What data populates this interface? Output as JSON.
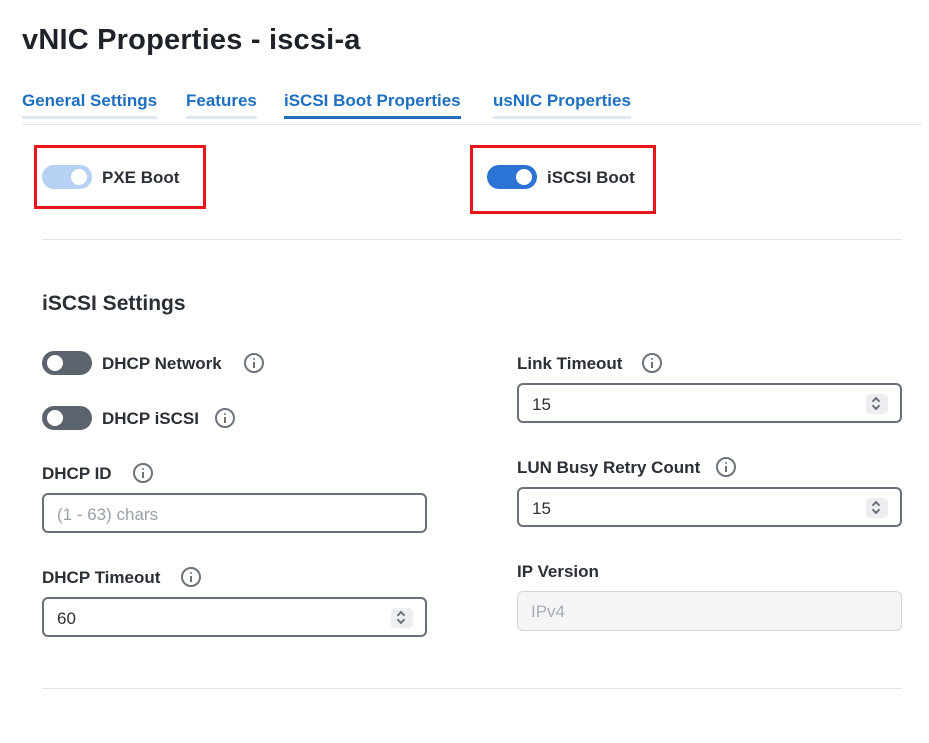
{
  "page": {
    "title": "vNIC Properties - iscsi-a"
  },
  "tabs": [
    "General Settings",
    "Features",
    "iSCSI Boot Properties",
    "usNIC Properties"
  ],
  "active_tab": "iSCSI Boot Properties",
  "boot": {
    "pxe": {
      "label": "PXE Boot",
      "state": "on",
      "disabled": true
    },
    "iscsi": {
      "label": "iSCSI Boot",
      "state": "on"
    }
  },
  "settings": {
    "title": "iSCSI Settings",
    "dhcp_network": {
      "label": "DHCP Network",
      "state": "off"
    },
    "dhcp_iscsi": {
      "label": "DHCP iSCSI",
      "state": "off"
    },
    "dhcp_id": {
      "label": "DHCP ID",
      "placeholder": "(1 - 63) chars",
      "value": ""
    },
    "dhcp_timeout": {
      "label": "DHCP Timeout",
      "value": "60"
    },
    "link_timeout": {
      "label": "Link Timeout",
      "value": "15"
    },
    "lun_busy_retry_count": {
      "label": "LUN Busy Retry Count",
      "value": "15"
    },
    "ip_version": {
      "label": "IP Version",
      "value": "IPv4"
    }
  },
  "colors": {
    "accent": "#1e6fbf",
    "toggle_on": "#2b74d6",
    "toggle_disabled": "#b6d1f3",
    "toggle_off": "#5b636d",
    "highlight": "#e8141c"
  }
}
